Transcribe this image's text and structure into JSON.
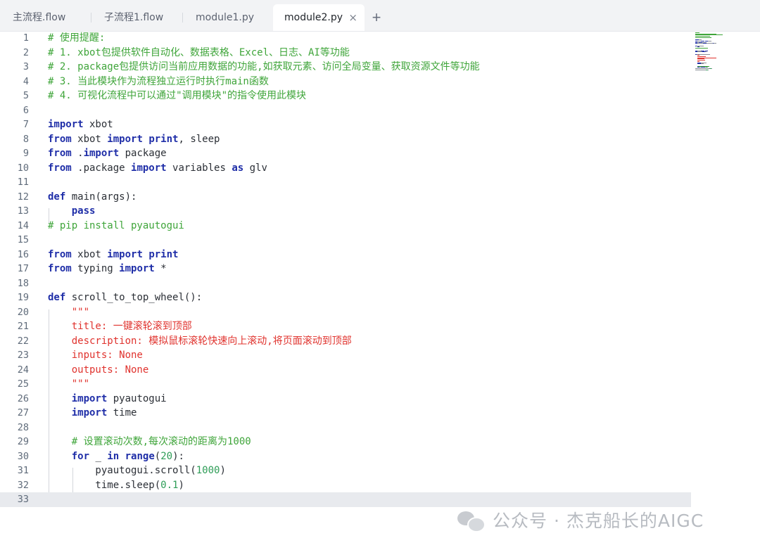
{
  "tabs": [
    {
      "label": "主流程.flow",
      "active": false
    },
    {
      "label": "子流程1.flow",
      "active": false
    },
    {
      "label": "module1.py",
      "active": false
    },
    {
      "label": "module2.py",
      "active": true
    }
  ],
  "close_glyph": "×",
  "add_glyph": "+",
  "watermark": {
    "text": "公众号 · 杰克船长的AIGC",
    "icon": "wechat-icon"
  },
  "colors": {
    "comment": "#3fa53a",
    "keyword": "#1f2ea8",
    "string": "#e0332e",
    "number": "#2e9d57",
    "current_line": "#e8eaee"
  },
  "editor": {
    "current_line": 33,
    "lines": [
      {
        "n": "1",
        "tokens": [
          [
            "cm",
            "# 使用提醒:"
          ]
        ]
      },
      {
        "n": "2",
        "tokens": [
          [
            "cm",
            "# 1. xbot包提供软件自动化、数据表格、Excel、日志、AI等功能"
          ]
        ]
      },
      {
        "n": "3",
        "tokens": [
          [
            "cm",
            "# 2. package包提供访问当前应用数据的功能,如获取元素、访问全局变量、获取资源文件等功能"
          ]
        ]
      },
      {
        "n": "4",
        "tokens": [
          [
            "cm",
            "# 3. 当此模块作为流程独立运行时执行main函数"
          ]
        ]
      },
      {
        "n": "5",
        "tokens": [
          [
            "cm",
            "# 4. 可视化流程中可以通过\"调用模块\"的指令使用此模块"
          ]
        ]
      },
      {
        "n": "6",
        "tokens": []
      },
      {
        "n": "7",
        "tokens": [
          [
            "kw",
            "import"
          ],
          [
            "id",
            " xbot"
          ]
        ]
      },
      {
        "n": "8",
        "tokens": [
          [
            "kw",
            "from"
          ],
          [
            "id",
            " xbot "
          ],
          [
            "kw",
            "import"
          ],
          [
            "id",
            " "
          ],
          [
            "kw",
            "print"
          ],
          [
            "id",
            ", sleep"
          ]
        ]
      },
      {
        "n": "9",
        "tokens": [
          [
            "kw",
            "from"
          ],
          [
            "id",
            " ."
          ],
          [
            "kw",
            "import"
          ],
          [
            "id",
            " package"
          ]
        ]
      },
      {
        "n": "10",
        "tokens": [
          [
            "kw",
            "from"
          ],
          [
            "id",
            " .package "
          ],
          [
            "kw",
            "import"
          ],
          [
            "id",
            " variables "
          ],
          [
            "kw",
            "as"
          ],
          [
            "id",
            " glv"
          ]
        ]
      },
      {
        "n": "11",
        "tokens": []
      },
      {
        "n": "12",
        "tokens": [
          [
            "kw",
            "def"
          ],
          [
            "id",
            " main(args):"
          ]
        ]
      },
      {
        "n": "13",
        "tokens": [
          [
            "id",
            "    "
          ],
          [
            "kw",
            "pass"
          ]
        ]
      },
      {
        "n": "14",
        "tokens": [
          [
            "cm",
            "# pip install pyautogui"
          ]
        ]
      },
      {
        "n": "15",
        "tokens": []
      },
      {
        "n": "16",
        "tokens": [
          [
            "kw",
            "from"
          ],
          [
            "id",
            " xbot "
          ],
          [
            "kw",
            "import"
          ],
          [
            "id",
            " "
          ],
          [
            "kw",
            "print"
          ]
        ]
      },
      {
        "n": "17",
        "tokens": [
          [
            "kw",
            "from"
          ],
          [
            "id",
            " typing "
          ],
          [
            "kw",
            "import"
          ],
          [
            "id",
            " *"
          ]
        ]
      },
      {
        "n": "18",
        "tokens": []
      },
      {
        "n": "19",
        "tokens": [
          [
            "kw",
            "def"
          ],
          [
            "id",
            " scroll_to_top_wheel():"
          ]
        ]
      },
      {
        "n": "20",
        "tokens": [
          [
            "id",
            "    "
          ],
          [
            "str",
            "\"\"\""
          ]
        ]
      },
      {
        "n": "21",
        "tokens": [
          [
            "id",
            "    "
          ],
          [
            "str",
            "title: 一键滚轮滚到顶部"
          ]
        ]
      },
      {
        "n": "22",
        "tokens": [
          [
            "id",
            "    "
          ],
          [
            "str",
            "description: 模拟鼠标滚轮快速向上滚动,将页面滚动到顶部"
          ]
        ]
      },
      {
        "n": "23",
        "tokens": [
          [
            "id",
            "    "
          ],
          [
            "str",
            "inputs: None"
          ]
        ]
      },
      {
        "n": "24",
        "tokens": [
          [
            "id",
            "    "
          ],
          [
            "str",
            "outputs: None"
          ]
        ]
      },
      {
        "n": "25",
        "tokens": [
          [
            "id",
            "    "
          ],
          [
            "str",
            "\"\"\""
          ]
        ]
      },
      {
        "n": "26",
        "tokens": [
          [
            "id",
            "    "
          ],
          [
            "kw",
            "import"
          ],
          [
            "id",
            " pyautogui"
          ]
        ]
      },
      {
        "n": "27",
        "tokens": [
          [
            "id",
            "    "
          ],
          [
            "kw",
            "import"
          ],
          [
            "id",
            " time"
          ]
        ]
      },
      {
        "n": "28",
        "tokens": []
      },
      {
        "n": "29",
        "tokens": [
          [
            "id",
            "    "
          ],
          [
            "cm",
            "# 设置滚动次数,每次滚动的距离为1000"
          ]
        ]
      },
      {
        "n": "30",
        "tokens": [
          [
            "id",
            "    "
          ],
          [
            "kw",
            "for"
          ],
          [
            "id",
            " _ "
          ],
          [
            "kw",
            "in"
          ],
          [
            "id",
            " "
          ],
          [
            "kw",
            "range"
          ],
          [
            "id",
            "("
          ],
          [
            "num",
            "20"
          ],
          [
            "id",
            "):"
          ]
        ]
      },
      {
        "n": "31",
        "tokens": [
          [
            "id",
            "        pyautogui.scroll("
          ],
          [
            "num",
            "1000"
          ],
          [
            "id",
            ")"
          ]
        ]
      },
      {
        "n": "32",
        "tokens": [
          [
            "id",
            "        time.sleep("
          ],
          [
            "num",
            "0.1"
          ],
          [
            "id",
            ")"
          ]
        ]
      },
      {
        "n": "33",
        "tokens": []
      }
    ]
  }
}
